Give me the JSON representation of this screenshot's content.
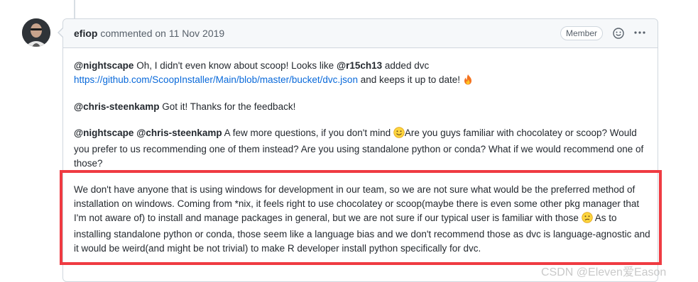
{
  "comment": {
    "author": "efiop",
    "action_text": " commented on 11 Nov 2019",
    "badge": "Member",
    "icons": {
      "reaction": "smiley-icon",
      "menu": "kebab-icon"
    },
    "para1": {
      "mention1": "@nightscape",
      "text1": " Oh, I didn't even know about scoop! Looks like ",
      "mention2": "@r15ch13",
      "text2": " added dvc",
      "link": "https://github.com/ScoopInstaller/Main/blob/master/bucket/dvc.json",
      "text3": " and keeps it up to date! ",
      "emoji": "fire-icon"
    },
    "para2": {
      "mention": "@chris-steenkamp",
      "text": " Got it! Thanks for the feedback!"
    },
    "para3": {
      "mention1": "@nightscape",
      "mention2": "@chris-steenkamp",
      "text1": " A few more questions, if you don't mind ",
      "emoji": "smile-icon",
      "text2": "Are you guys familiar with chocolatey or scoop? Would you prefer to us recommending one of them instead? Are you using standalone python or conda? What if we would recommend one of those?"
    },
    "para4": {
      "text1": "We don't have anyone that is using windows for development in our team, so we are not sure what would be the preferred method of installation on windows. Coming from *nix, it feels right to use chocolatey or scoop(maybe there is even some other pkg manager that I'm not aware of) to install and manage packages in general, but we are not sure if our typical user is familiar with those ",
      "emoji": "confused-icon",
      "text2": " As to installing standalone python or conda, those seem like a language bias and we don't recommend those as dvc is language-agnostic and it would be weird(and might be not trivial) to make R developer install python specifically for dvc."
    }
  },
  "highlight_color": "#ef3b42",
  "watermark": "CSDN @Eleven爱Eason"
}
